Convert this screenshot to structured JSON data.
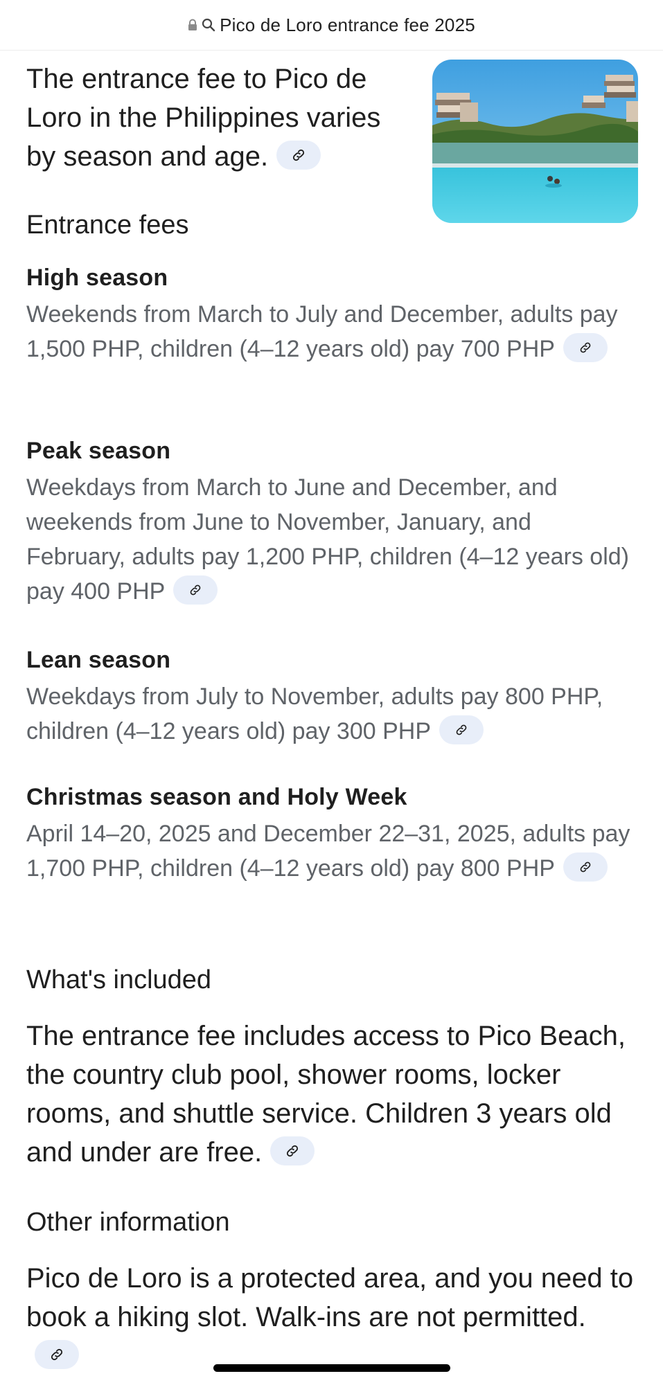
{
  "header": {
    "title": "Pico de Loro entrance fee 2025",
    "lock_icon": "lock-icon",
    "search_icon": "search-icon"
  },
  "intro": {
    "text": "The entrance fee to Pico de Loro in the Philippines varies by season and age."
  },
  "sections": {
    "fees_heading": "Entrance fees",
    "seasons": [
      {
        "title": "High season",
        "desc": "Weekends from March to July and December, adults pay 1,500 PHP, children (4–12 years old) pay 700 PHP"
      },
      {
        "title": "Peak season",
        "desc": "Weekdays from March to June and December, and weekends from June to November, January, and February, adults pay 1,200 PHP, children (4–12 years old) pay 400 PHP"
      },
      {
        "title": "Lean season",
        "desc": "Weekdays from July to November, adults pay 800 PHP, children (4–12 years old) pay 300 PHP"
      },
      {
        "title": "Christmas season and Holy Week",
        "desc": "April 14–20, 2025 and December 22–31, 2025, adults pay 1,700 PHP, children (4–12 years old) pay 800 PHP"
      }
    ],
    "included_heading": "What's included",
    "included_text": "The entrance fee includes access to Pico Beach, the country club pool, shower rooms, locker rooms, and shuttle service. Children 3 years old and under are free.",
    "other_heading": "Other information",
    "other_text": "Pico de Loro is a protected area, and you need to book a hiking slot. Walk-ins are not permitted."
  },
  "colors": {
    "chip_bg": "#e8eef9",
    "body_text": "#1f1f1f",
    "muted_text": "#5f6368"
  }
}
